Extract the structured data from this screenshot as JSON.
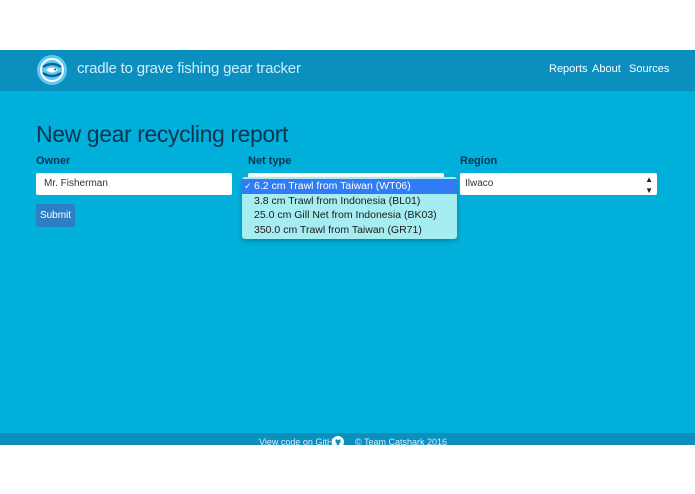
{
  "navbar": {
    "brand": "cradle to grave fishing gear tracker",
    "logo_icon": "fish-cycle-logo-icon",
    "links": [
      "Reports",
      "About",
      "Sources"
    ]
  },
  "main": {
    "title": "New gear recycling report",
    "owner": {
      "label": "Owner",
      "value": "Mr. Fisherman"
    },
    "net_type": {
      "label": "Net type",
      "options": [
        "6.2 cm Trawl from Taiwan (WT06)",
        "3.8 cm Trawl from Indonesia (BL01)",
        "25.0 cm Gill Net from Indonesia (BK03)",
        "350.0 cm Trawl from Taiwan (GR71)"
      ],
      "selected_mark": "✓"
    },
    "region": {
      "label": "Region",
      "value": "Ilwaco",
      "arrows_icon": "select-arrows-icon"
    },
    "submit_label": "Submit"
  },
  "footer": {
    "github_text": "View code on GitHub",
    "github_icon": "github-icon",
    "copyright": "© Team Catshark 2016"
  },
  "colors": {
    "navbar": "#0a8fbf",
    "main_bg": "#00b0db",
    "submit": "#2d7fc4",
    "dropdown_bg": "#a6edf1",
    "selected_option": "#2f7cf6"
  }
}
